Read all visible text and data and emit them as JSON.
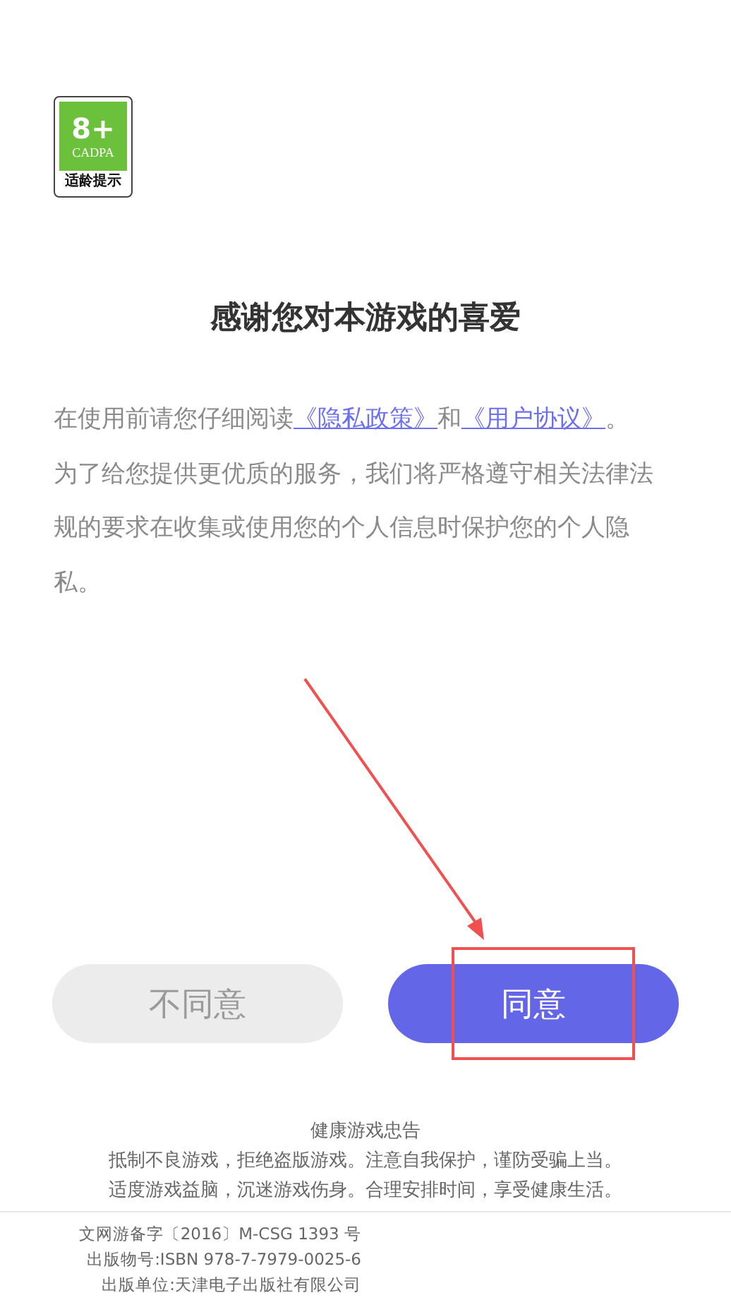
{
  "rating_badge": {
    "age": "8+",
    "org": "CADPA",
    "caption": "适龄提示"
  },
  "title": "感谢您对本游戏的喜爱",
  "intro": [
    {
      "kind": "text",
      "text": "在使用前请您仔细阅读"
    },
    {
      "kind": "link",
      "text": "《隐私政策》"
    },
    {
      "kind": "text",
      "text": "和"
    },
    {
      "kind": "link",
      "text": "《用户协议》"
    },
    {
      "kind": "text",
      "text": "。"
    }
  ],
  "body": "为了给您提供更优质的服务，我们将严格遵守相关法律法规的要求在收集或使用您的个人信息时保护您的个人隐私。",
  "buttons": [
    {
      "label": "不同意",
      "kind": "secondary"
    },
    {
      "label": "同意",
      "kind": "primary"
    }
  ],
  "advice": {
    "title": "健康游戏忠告",
    "lines": [
      "抵制不良游戏，拒绝盗版游戏。注意自我保护，谨防受骗上当。",
      "适度游戏益脑，沉迷游戏伤身。合理安排时间，享受健康生活。"
    ]
  },
  "publishing": [
    "文网游备字〔2016〕M-CSG 1393 号",
    "出版物号:ISBN 978-7-7979-0025-6",
    "出版单位:天津电子出版社有限公司"
  ]
}
